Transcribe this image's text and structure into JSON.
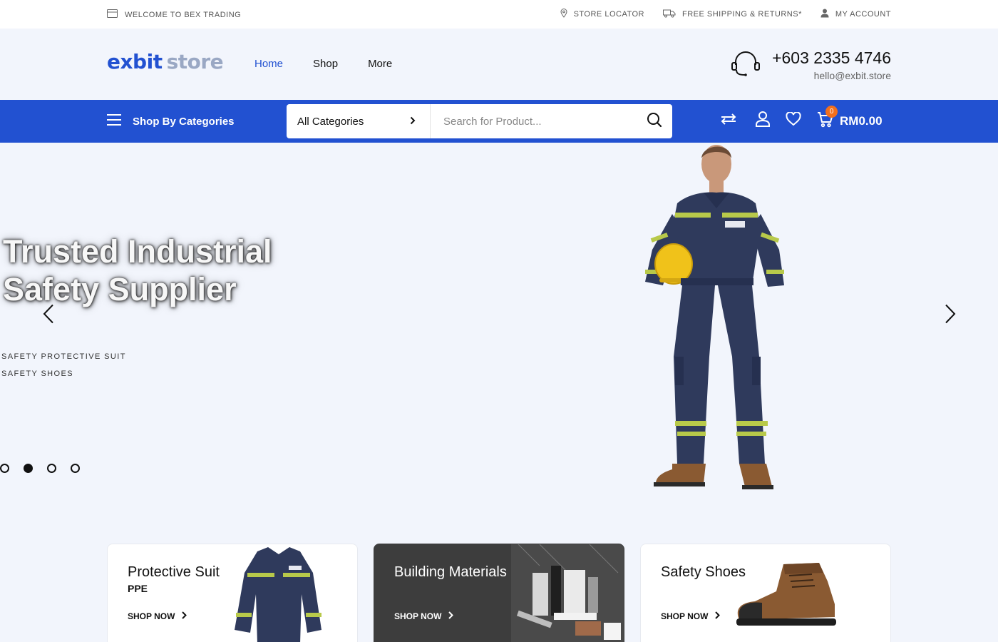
{
  "topbar": {
    "welcome": "WELCOME TO BEX TRADING",
    "store_locator": "STORE LOCATOR",
    "shipping": "FREE SHIPPING & RETURNS*",
    "account": "MY ACCOUNT"
  },
  "header": {
    "logo_part1": "exbit",
    "logo_part2": "store",
    "nav": [
      {
        "label": "Home",
        "active": true
      },
      {
        "label": "Shop"
      },
      {
        "label": "More"
      }
    ],
    "phone": "+603 2335 4746",
    "email": "hello@exbit.store"
  },
  "bluebar": {
    "categories_button": "Shop By Categories",
    "category_select": "All Categories",
    "search_placeholder": "Search for Product...",
    "cart_count": "0",
    "cart_total": "RM0.00",
    "accent": "#2251d1",
    "badge_color": "#f36f1c"
  },
  "hero": {
    "title_line1": "Trusted Industrial",
    "title_line2": "Safety Supplier",
    "links": [
      "SAFETY PROTECTIVE SUIT",
      "SAFETY SHOES"
    ],
    "slides": 4,
    "active_slide": 2
  },
  "promos": [
    {
      "title": "Protective Suit",
      "subtitle": "PPE",
      "cta": "SHOP NOW"
    },
    {
      "title": "Building Materials",
      "subtitle": "",
      "cta": "SHOP NOW"
    },
    {
      "title": "Safety Shoes",
      "subtitle": "",
      "cta": "SHOP NOW"
    }
  ]
}
